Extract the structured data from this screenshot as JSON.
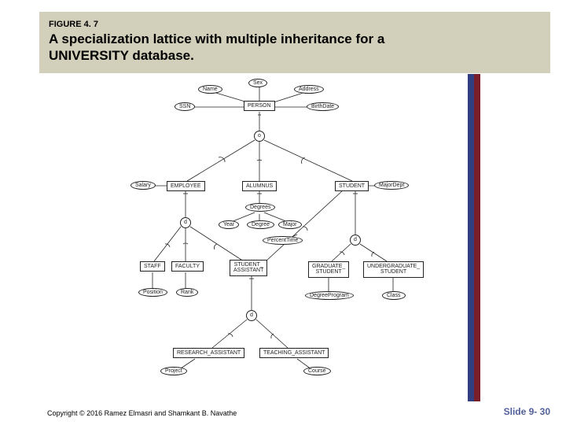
{
  "header": {
    "figure_label": "FIGURE 4. 7",
    "title_line1": "A specialization lattice with multiple inheritance for a",
    "title_line2": "UNIVERSITY database."
  },
  "diagram": {
    "attrs": {
      "sex": "Sex",
      "name": "Name",
      "address": "Address",
      "ssn": "SSN",
      "birthdate": "BirthDate",
      "salary": "Salary",
      "majordept": "MajorDept",
      "degrees": "Degrees",
      "year": "Year",
      "degree": "Degree",
      "major": "Major",
      "percenttime": "PercentTime",
      "position": "Position",
      "rank": "Rank",
      "degreeprogram": "DegreeProgram",
      "class": "Class",
      "project": "Project",
      "course": "Course"
    },
    "entities": {
      "person": "PERSON",
      "employee": "EMPLOYEE",
      "alumnus": "ALUMNUS",
      "student": "STUDENT",
      "staff": "STAFF",
      "faculty": "FACULTY",
      "student_assistant_l1": "STUDENT_",
      "student_assistant_l2": "ASSISTANT",
      "graduate_student_l1": "GRADUATE_",
      "graduate_student_l2": "STUDENT",
      "undergraduate_student_l1": "UNDERGRADUATE_",
      "undergraduate_student_l2": "STUDENT",
      "research_assistant": "RESEARCH_ASSISTANT",
      "teaching_assistant": "TEACHING_ASSISTANT"
    },
    "circles": {
      "o": "o",
      "d1": "d",
      "d2": "d",
      "d3": "d"
    }
  },
  "footer": {
    "copyright": "Copyright © 2016 Ramez Elmasri and Shamkant B. Navathe",
    "slide": "Slide 9- 30"
  }
}
